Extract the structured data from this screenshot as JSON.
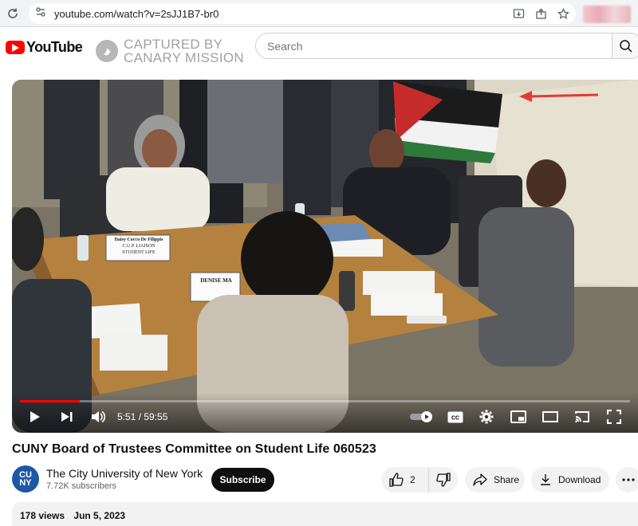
{
  "browser": {
    "url": "youtube.com/watch?v=2sJJ1B7-br0"
  },
  "header": {
    "logo_text": "YouTube",
    "watermark_line1": "CAPTURED BY",
    "watermark_line2": "CANARY MISSION",
    "search_placeholder": "Search"
  },
  "player": {
    "current_time": "5:51 / 59:55",
    "progress": 0.098,
    "accent": "#ff0000"
  },
  "scene": {
    "name_tent_1_line1": "Daisy Cocco De Filippis",
    "name_tent_1_line2": "C.U.P. LIAISON",
    "name_tent_1_line3": "STUDENT LIFE",
    "name_tent_2_line1": "DENISE MA"
  },
  "video": {
    "title": "CUNY Board of Trustees Committee on Student Life 060523"
  },
  "channel": {
    "avatar_text": "CU NY",
    "name": "The City University of New York",
    "subscribers": "7.72K subscribers",
    "subscribe_label": "Subscribe"
  },
  "actions": {
    "like_count": "2",
    "share_label": "Share",
    "download_label": "Download"
  },
  "description": {
    "views": "178 views",
    "date": "Jun 5, 2023"
  }
}
